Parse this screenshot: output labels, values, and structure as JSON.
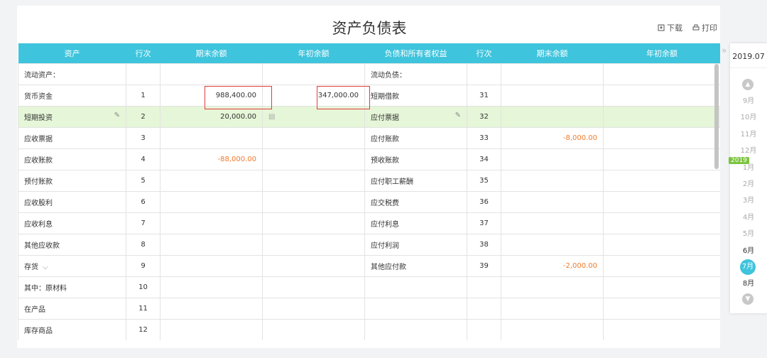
{
  "title": "资产负债表",
  "actions": {
    "download": "下载",
    "print": "打印"
  },
  "headers": [
    "资产",
    "行次",
    "期末余额",
    "年初余额",
    "负债和所有者权益",
    "行次",
    "期末余额",
    "年初余额"
  ],
  "rows": [
    {
      "a": "流动资产：",
      "an": "",
      "ae": "",
      "ab": "",
      "l": "流动负债：",
      "ln": "",
      "le": "",
      "lb": ""
    },
    {
      "a": "货币资金",
      "an": "1",
      "ae": "988,400.00",
      "ab": "347,000.00",
      "l": "短期借款",
      "ln": "31",
      "le": "",
      "lb": ""
    },
    {
      "a": "短期投资",
      "an": "2",
      "ae": "20,000.00",
      "ab": "",
      "l": "应付票据",
      "ln": "32",
      "le": "",
      "lb": ""
    },
    {
      "a": "应收票据",
      "an": "3",
      "ae": "",
      "ab": "",
      "l": "应付账款",
      "ln": "33",
      "le": "-8,000.00",
      "lb": ""
    },
    {
      "a": "应收账款",
      "an": "4",
      "ae": "-88,000.00",
      "ab": "",
      "l": "预收账款",
      "ln": "34",
      "le": "",
      "lb": ""
    },
    {
      "a": "预付账款",
      "an": "5",
      "ae": "",
      "ab": "",
      "l": "应付职工薪酬",
      "ln": "35",
      "le": "",
      "lb": ""
    },
    {
      "a": "应收股利",
      "an": "6",
      "ae": "",
      "ab": "",
      "l": "应交税费",
      "ln": "36",
      "le": "",
      "lb": ""
    },
    {
      "a": "应收利息",
      "an": "7",
      "ae": "",
      "ab": "",
      "l": "应付利息",
      "ln": "37",
      "le": "",
      "lb": ""
    },
    {
      "a": "其他应收款",
      "an": "8",
      "ae": "",
      "ab": "",
      "l": "应付利润",
      "ln": "38",
      "le": "",
      "lb": ""
    },
    {
      "a": "存货",
      "an": "9",
      "ae": "",
      "ab": "",
      "l": "其他应付款",
      "ln": "39",
      "le": "-2,000.00",
      "lb": ""
    },
    {
      "a": "其中：原材料",
      "an": "10",
      "ae": "",
      "ab": "",
      "l": "",
      "ln": "",
      "le": "",
      "lb": ""
    },
    {
      "a": "在产品",
      "an": "11",
      "ae": "",
      "ab": "",
      "l": "",
      "ln": "",
      "le": "",
      "lb": ""
    },
    {
      "a": "库存商品",
      "an": "12",
      "ae": "",
      "ab": "",
      "l": "",
      "ln": "",
      "le": "",
      "lb": ""
    }
  ],
  "sidebar": {
    "year": "2019.07",
    "year_badge": "2019",
    "months": [
      "9月",
      "10月",
      "11月",
      "12月",
      "1月",
      "2月",
      "3月",
      "4月",
      "5月",
      "6月",
      "7月",
      "8月"
    ],
    "current": "7月"
  },
  "colors": {
    "header": "#3ec4dd",
    "highlight_row": "#e6f6d8",
    "negative": "#f07a2c",
    "box": "#e23b3b"
  }
}
